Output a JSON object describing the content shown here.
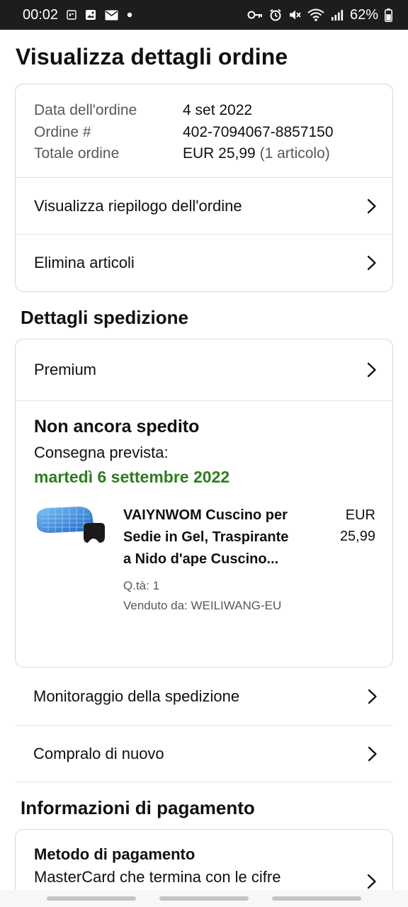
{
  "status_bar": {
    "time": "00:02",
    "battery": "62%",
    "left_icons": [
      "news-icon",
      "gallery-icon",
      "mail-icon",
      "dot-icon"
    ],
    "right_icons": [
      "key-icon",
      "alarm-icon",
      "mute-icon",
      "wifi-icon",
      "signal-icon",
      "battery-icon"
    ]
  },
  "page": {
    "title": "Visualizza dettagli ordine"
  },
  "order": {
    "date_label": "Data dell'ordine",
    "date_value": "4 set 2022",
    "number_label": "Ordine #",
    "number_value": "402-7094067-8857150",
    "total_label": "Totale ordine",
    "total_value": "EUR 25,99",
    "total_items": "(1 articolo)"
  },
  "order_actions": {
    "summary": "Visualizza riepilogo dell'ordine",
    "delete": "Elimina articoli"
  },
  "shipping": {
    "section_title": "Dettagli spedizione",
    "method": "Premium",
    "status": "Non ancora spedito",
    "expected_label": "Consegna prevista:",
    "expected_date": "martedì 6 settembre 2022",
    "accent_color": "#2e7d1f"
  },
  "item": {
    "title": "VAIYNWOM Cuscino per Sedie in Gel, Traspirante a Nido d'ape Cuscino...",
    "qty": "Q.tà: 1",
    "seller": "Venduto da: WEILIWANG-EU",
    "price_currency": "EUR",
    "price_amount": "25,99"
  },
  "shipping_actions": {
    "track": "Monitoraggio della spedizione",
    "buy_again": "Compralo di nuovo"
  },
  "payment": {
    "section_title": "Informazioni di pagamento",
    "method_title": "Metodo di pagamento",
    "method_desc": "MasterCard che termina con le cifre"
  }
}
